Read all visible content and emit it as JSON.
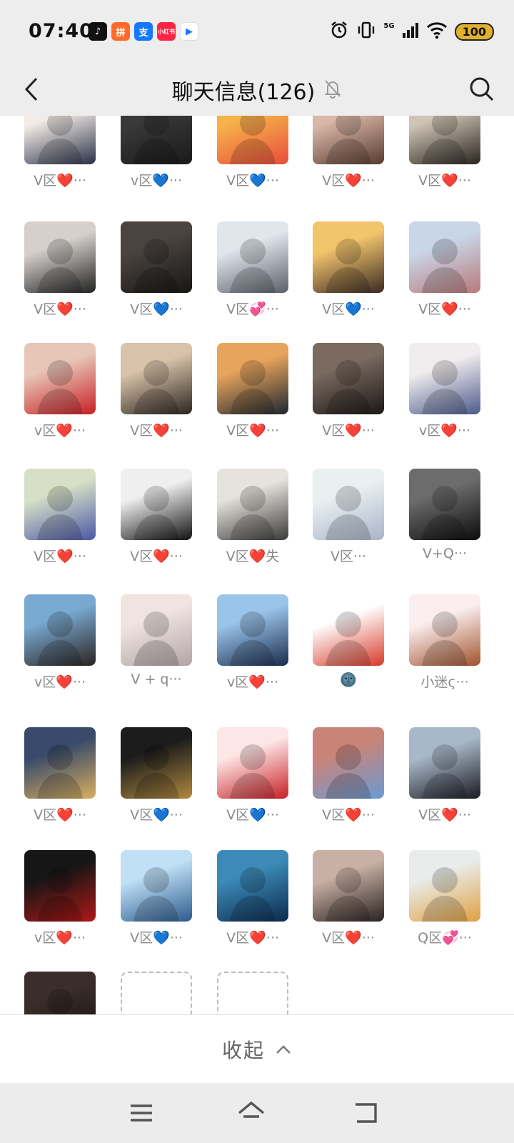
{
  "status_bar": {
    "time": "07:40",
    "network": "5G",
    "battery": "100",
    "app_icons": [
      {
        "name": "tiktok-icon",
        "color": "#111111",
        "glyph": "♪"
      },
      {
        "name": "shopping-app-icon",
        "color": "#ff6a2b",
        "glyph": "拼"
      },
      {
        "name": "alipay-icon",
        "color": "#1677ff",
        "glyph": "支"
      },
      {
        "name": "xiaohongshu-icon",
        "color": "#ff2442",
        "glyph": "小红书"
      },
      {
        "name": "video-app-icon",
        "color": "#ffffff",
        "glyph": "▶"
      }
    ]
  },
  "header": {
    "title": "聊天信息(126)"
  },
  "members": [
    {
      "label": "V区❤️···",
      "colors": [
        "#f3ece6",
        "#2a3148"
      ]
    },
    {
      "label": "v区💙···",
      "colors": [
        "#3a3a3a",
        "#1a1a1a"
      ]
    },
    {
      "label": "V区💙···",
      "colors": [
        "#f7b24a",
        "#e84d3c"
      ]
    },
    {
      "label": "V区❤️···",
      "colors": [
        "#d9b8a8",
        "#5a3b30"
      ]
    },
    {
      "label": "V区❤️···",
      "colors": [
        "#cfc5b5",
        "#2a2420"
      ]
    },
    {
      "label": "V区❤️···",
      "colors": [
        "#d5d0cc",
        "#222222"
      ]
    },
    {
      "label": "V区💙···",
      "colors": [
        "#4a4440",
        "#181614"
      ]
    },
    {
      "label": "V区💞···",
      "colors": [
        "#dfe6ec",
        "#5a6068"
      ]
    },
    {
      "label": "V区💙···",
      "colors": [
        "#f2c46c",
        "#3a2a24"
      ]
    },
    {
      "label": "V区❤️···",
      "colors": [
        "#c9d6e8",
        "#b87a7a"
      ]
    },
    {
      "label": "v区❤️···",
      "colors": [
        "#e7c6b8",
        "#c81f24"
      ]
    },
    {
      "label": "V区❤️···",
      "colors": [
        "#d8c2a8",
        "#2a2420"
      ]
    },
    {
      "label": "V区❤️···",
      "colors": [
        "#e7a45c",
        "#1e2630"
      ]
    },
    {
      "label": "V区❤️···",
      "colors": [
        "#7a6a60",
        "#1c1816"
      ]
    },
    {
      "label": "v区❤️···",
      "colors": [
        "#f1ecee",
        "#4a5a8c"
      ]
    },
    {
      "label": "V区❤️···",
      "colors": [
        "#d7e0c6",
        "#4a58a8"
      ]
    },
    {
      "label": "V区❤️···",
      "colors": [
        "#efefef",
        "#111111"
      ]
    },
    {
      "label": "V区❤️失",
      "colors": [
        "#e6e2dc",
        "#3a3a3a"
      ]
    },
    {
      "label": "V区···",
      "colors": [
        "#eaf0f2",
        "#a8b4c8"
      ]
    },
    {
      "label": "V+Q···",
      "colors": [
        "#6c6c6c",
        "#0c0c0c"
      ]
    },
    {
      "label": "v区❤️···",
      "colors": [
        "#79a8d0",
        "#2a2420"
      ]
    },
    {
      "label": "V + q···",
      "colors": [
        "#f0e4e0",
        "#b0a4a8"
      ]
    },
    {
      "label": "v区❤️···",
      "colors": [
        "#9ac4ea",
        "#1a2c4c"
      ]
    },
    {
      "label": "🌚",
      "colors": [
        "#ffffff",
        "#d83a28"
      ]
    },
    {
      "label": "小迷ς···",
      "colors": [
        "#fbeeee",
        "#a0522d"
      ]
    },
    {
      "label": "V区❤️···",
      "colors": [
        "#3a4a6a",
        "#d8b060"
      ]
    },
    {
      "label": "V区💙···",
      "colors": [
        "#1c1c1c",
        "#b08a40"
      ]
    },
    {
      "label": "V区💙···",
      "colors": [
        "#fde6e6",
        "#c81f24"
      ]
    },
    {
      "label": "V区❤️···",
      "colors": [
        "#c98478",
        "#6a9ad4"
      ]
    },
    {
      "label": "V区❤️···",
      "colors": [
        "#a8b8c8",
        "#1a1a22"
      ]
    },
    {
      "label": "v区❤️···",
      "colors": [
        "#161616",
        "#b01818"
      ]
    },
    {
      "label": "V区💙···",
      "colors": [
        "#bfe0f6",
        "#2c5a8c"
      ]
    },
    {
      "label": "V区❤️···",
      "colors": [
        "#3c8ab8",
        "#0c2a4c"
      ]
    },
    {
      "label": "V区❤️···",
      "colors": [
        "#c8b0a4",
        "#2a2220"
      ]
    },
    {
      "label": "Q区💞···",
      "colors": [
        "#e8ecea",
        "#e0a040"
      ]
    },
    {
      "label": "",
      "colors": [
        "#3a2e2a",
        "#141010"
      ]
    }
  ],
  "add_buttons": [
    {
      "name": "add-member-button"
    },
    {
      "name": "remove-member-button"
    }
  ],
  "footer": {
    "collapse_label": "收起"
  }
}
